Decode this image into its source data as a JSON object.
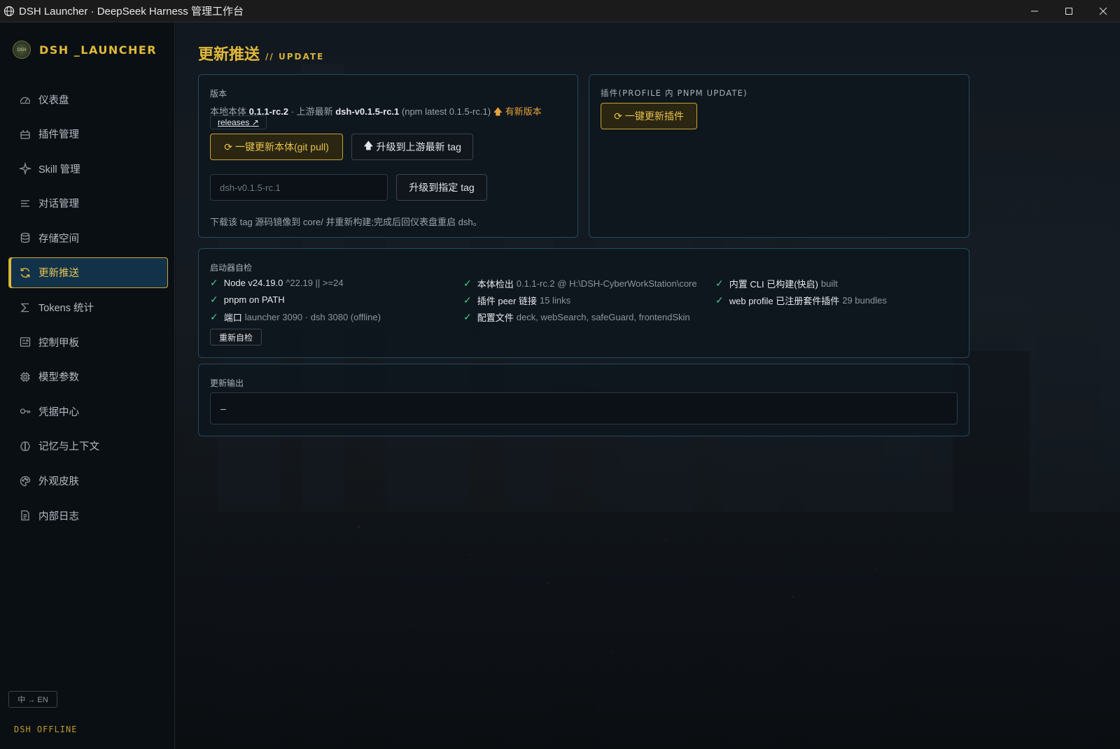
{
  "window": {
    "title": "DSH Launcher · DeepSeek Harness 管理工作台"
  },
  "brand": {
    "logo_text": "DSH",
    "name": "DSH _LAUNCHER"
  },
  "sidebar": {
    "items": [
      {
        "label": "仪表盘",
        "icon": "dashboard-icon"
      },
      {
        "label": "插件管理",
        "icon": "plugin-icon"
      },
      {
        "label": "Skill 管理",
        "icon": "sparkle-icon"
      },
      {
        "label": "对话管理",
        "icon": "list-icon"
      },
      {
        "label": "存储空间",
        "icon": "database-icon"
      },
      {
        "label": "更新推送",
        "icon": "refresh-icon",
        "active": true
      },
      {
        "label": "Tokens 统计",
        "icon": "sigma-icon"
      },
      {
        "label": "控制甲板",
        "icon": "panel-icon"
      },
      {
        "label": "模型参数",
        "icon": "chip-icon"
      },
      {
        "label": "凭据中心",
        "icon": "key-icon"
      },
      {
        "label": "记忆与上下文",
        "icon": "brain-icon"
      },
      {
        "label": "外观皮肤",
        "icon": "palette-icon"
      },
      {
        "label": "内部日志",
        "icon": "document-icon"
      }
    ],
    "lang_toggle": "中 → EN",
    "status": "DSH OFFLINE"
  },
  "page": {
    "title": "更新推送",
    "subtitle": "// UPDATE"
  },
  "version_card": {
    "label": "版本",
    "local_prefix": "本地本体",
    "local_version": "0.1.1-rc.2",
    "upstream_prefix": "· 上游最新",
    "upstream_version": "dsh-v0.1.5-rc.1",
    "npm_note": "(npm latest 0.1.5-rc.1)",
    "new_version_label": "有新版本",
    "releases_link": "releases ↗",
    "btn_git_pull": "一键更新本体(git pull)",
    "btn_upgrade_latest": "升级到上游最新 tag",
    "tag_input_placeholder": "dsh-v0.1.5-rc.1",
    "btn_upgrade_tag": "升级到指定 tag",
    "hint": "下载该 tag 源码镜像到 core/ 并重新构建;完成后回仪表盘重启 dsh。"
  },
  "plugin_card": {
    "label": "插件(PROFILE 内 PNPM UPDATE)",
    "btn_update_plugins": "一键更新插件"
  },
  "selfcheck_card": {
    "label": "启动器自检",
    "items": [
      {
        "key": "Node v24.19.0",
        "value": "^22.19 || >=24"
      },
      {
        "key": "pnpm on PATH",
        "value": ""
      },
      {
        "key": "端口",
        "value": "launcher 3090 · dsh 3080 (offline)"
      },
      {
        "key": "本体检出",
        "value": "0.1.1-rc.2 @ H:\\DSH-CyberWorkStation\\core"
      },
      {
        "key": "插件 peer 链接",
        "value": "15 links"
      },
      {
        "key": "配置文件",
        "value": "deck, webSearch, safeGuard, frontendSkin"
      },
      {
        "key": "内置 CLI 已构建(快启)",
        "value": "built"
      },
      {
        "key": "web profile 已注册套件插件",
        "value": "29 bundles"
      }
    ],
    "btn_recheck": "重新自检"
  },
  "output_card": {
    "label": "更新输出",
    "content": "–"
  },
  "colors": {
    "accent_gold": "#e1b93a",
    "check_green": "#3ed28a",
    "card_border": "#234a5e",
    "active_nav_bg": "#12324a"
  }
}
